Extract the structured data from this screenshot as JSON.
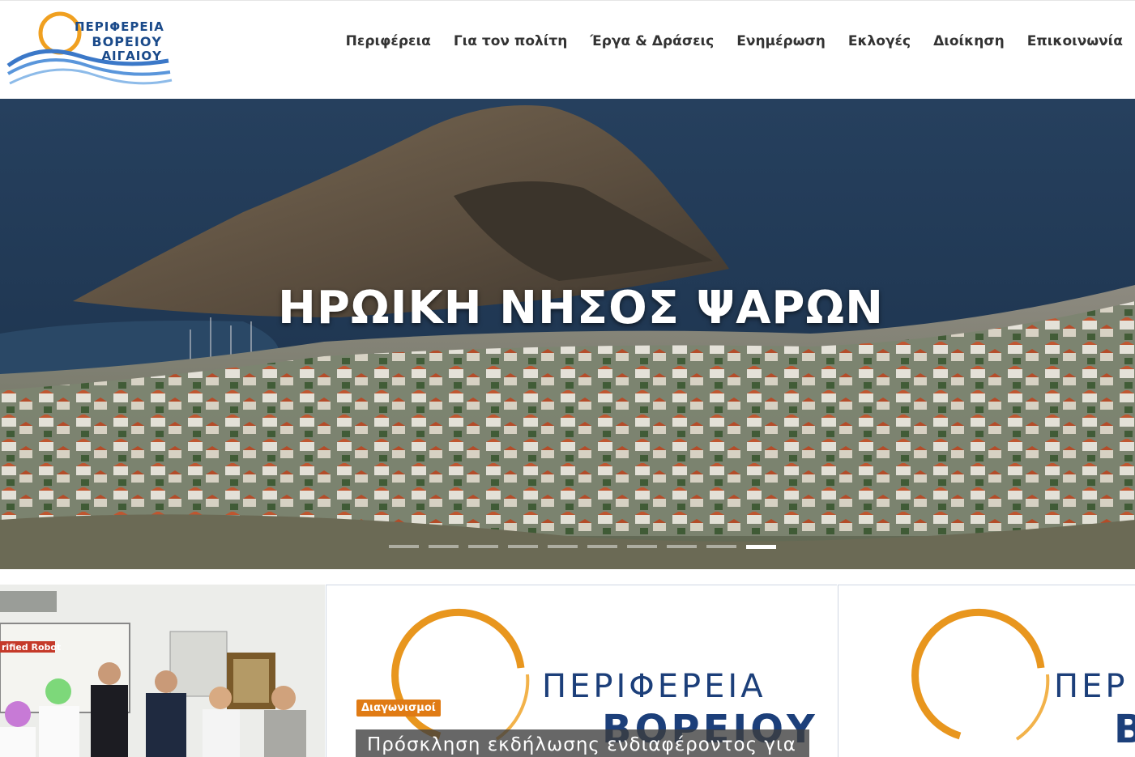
{
  "header": {
    "logo": {
      "line1": "ΠΕΡΙΦΕΡΕΙΑ",
      "line2": "ΒΟΡΕΙΟΥ",
      "line3": "ΑΙΓΑΙΟΥ"
    },
    "nav": [
      "Περιφέρεια",
      "Για τον πολίτη",
      "Έργα & Δράσεις",
      "Ενημέρωση",
      "Εκλογές",
      "Διοίκηση",
      "Επικοινωνία"
    ]
  },
  "hero": {
    "title": "ΗΡΩΙΚΗ ΝΗΣΟΣ ΨΑΡΩΝ",
    "slides_total": 10,
    "active_slide": 10
  },
  "cards": {
    "card1": {
      "poster_text": "rified Robot"
    },
    "card2": {
      "brand_line1": "ΠΕΡΙΦΕΡΕΙΑ",
      "brand_line2": "ΒΟΡΕΙΟΥ",
      "category": "Διαγωνισμοί",
      "caption": "Πρόσκληση εκδήλωσης ενδιαφέροντος για"
    },
    "card3": {
      "brand_line1": "ΠΕΡ",
      "brand_line2": "Β"
    }
  },
  "colors": {
    "brand_blue": "#1c3f7a",
    "brand_orange": "#e8961e",
    "badge_orange": "#e07b14",
    "sea": "#1c3550"
  }
}
